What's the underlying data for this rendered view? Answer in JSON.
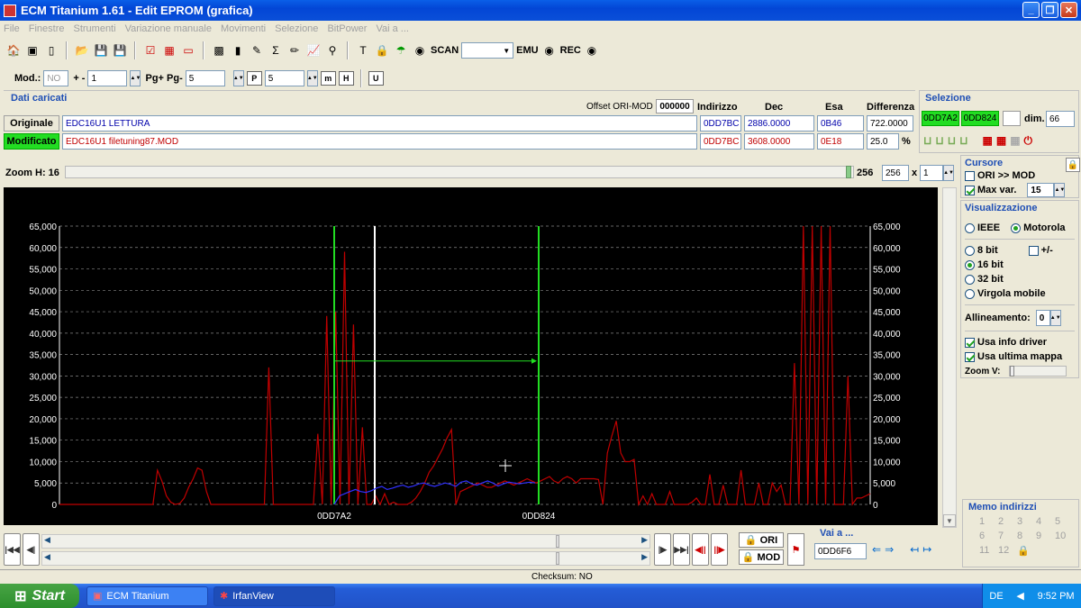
{
  "window": {
    "title": "ECM Titanium 1.61 - Edit EPROM (grafica)"
  },
  "menu": [
    "File",
    "Finestre",
    "Strumenti",
    "Variazione manuale",
    "Movimenti",
    "Selezione",
    "BitPower",
    "Vai a ..."
  ],
  "toolbar": {
    "scan_label": "SCAN",
    "emu_label": "EMU",
    "rec_label": "REC"
  },
  "toolbar2": {
    "mod_label": "Mod.:",
    "mod_value": "NO",
    "plusminus_label": "+ -",
    "plusminus_value": "1",
    "pg_label": "Pg+ Pg-",
    "pg_value": "5",
    "p_value": "5"
  },
  "dati": {
    "title": "Dati caricati",
    "offset_label": "Offset ORI-MOD",
    "offset_value": "000000",
    "col_indirizzo": "Indirizzo",
    "col_dec": "Dec",
    "col_esa": "Esa",
    "col_diff": "Differenza",
    "originale": {
      "label": "Originale",
      "file": "EDC16U1 LETTURA",
      "indirizzo": "0DD7BC",
      "dec": "2886.0000",
      "esa": "0B46",
      "diff": "722.0000"
    },
    "modificato": {
      "label": "Modificato",
      "file": "EDC16U1 filetuning87.MOD",
      "indirizzo": "0DD7BC",
      "dec": "3608.0000",
      "esa": "0E18",
      "diff": "25.0",
      "pct": "%"
    }
  },
  "selezione": {
    "title": "Selezione",
    "start": "0DD7A2",
    "end": "0DD824",
    "dim_label": "dim.",
    "dim_value": "66"
  },
  "zoom": {
    "label": "Zoom H: 16",
    "value_text": "256",
    "field": "256",
    "x_label": "x",
    "mult": "1"
  },
  "cursore": {
    "title": "Cursore",
    "ori_mod": "ORI >> MOD",
    "max_var_label": "Max var.",
    "max_var_value": "15"
  },
  "visualizzazione": {
    "title": "Visualizzazione",
    "ieee": "IEEE",
    "motorola": "Motorola",
    "bit8": "8 bit",
    "plusminus": "+/-",
    "bit16": "16 bit",
    "bit32": "32 bit",
    "virgola": "Virgola mobile",
    "allineamento_label": "Allineamento:",
    "allineamento_value": "0",
    "usa_info": "Usa info driver",
    "usa_ultima": "Usa ultima mappa",
    "zoomv_label": "Zoom V:"
  },
  "memo": {
    "title": "Memo indirizzi",
    "items": [
      "1",
      "2",
      "3",
      "4",
      "5",
      "6",
      "7",
      "8",
      "9",
      "10",
      "11",
      "12"
    ]
  },
  "bottom": {
    "ori_label": "ORI",
    "mod_label": "MOD",
    "vai_title": "Vai a ...",
    "vai_value": "0DD6F6",
    "checksum": "Checksum: NO"
  },
  "taskbar": {
    "start": "Start",
    "task1": "ECM Titanium",
    "task2": "IrfanView",
    "lang": "DE",
    "time": "9:52 PM"
  },
  "chart_data": {
    "type": "line",
    "ylim": [
      0,
      65000
    ],
    "y_ticks": [
      "0",
      "5,000",
      "10,000",
      "15,000",
      "20,000",
      "25,000",
      "30,000",
      "35,000",
      "40,000",
      "45,000",
      "50,000",
      "55,000",
      "60,000",
      "65,000"
    ],
    "x_tick_labels": [
      "0DD7A2",
      "0DD824"
    ],
    "series": [
      {
        "color": "#c00000",
        "values": [
          0,
          0,
          0,
          0,
          0,
          0,
          0,
          0,
          0,
          0,
          0,
          0,
          0,
          0,
          0,
          0,
          0,
          0,
          0,
          0,
          0,
          0,
          8000,
          5500,
          2000,
          500,
          0,
          200,
          1500,
          4000,
          6000,
          8500,
          8000,
          3000,
          0,
          0,
          0,
          0,
          0,
          0,
          0,
          0,
          0,
          0,
          0,
          0,
          0,
          32000,
          0,
          0,
          0,
          0,
          0,
          0,
          0,
          0,
          0,
          0,
          16500,
          0,
          44000,
          0,
          45000,
          0,
          59000,
          0,
          42000,
          0,
          18000,
          0,
          0,
          2000,
          0,
          2500,
          0,
          500,
          0,
          0,
          0,
          500,
          1500,
          3000,
          5000,
          7500,
          9000,
          11000,
          13000,
          15500,
          17500,
          0,
          3000,
          3500,
          4000,
          4500,
          5000,
          4500,
          4000,
          4000,
          4500,
          5000,
          5500,
          5000,
          4500,
          5000,
          5500,
          6000,
          5500,
          5000,
          5500,
          6000,
          6500,
          5500,
          5000,
          6000,
          6500,
          6000,
          5000,
          6000,
          6000,
          6000,
          6000,
          5800,
          0,
          12000,
          16000,
          19500,
          12000,
          10000,
          10000,
          10500,
          0,
          2000,
          0,
          2500,
          0,
          0,
          0,
          3000,
          0,
          0,
          0,
          0,
          500,
          1500,
          0,
          0,
          7000,
          0,
          0,
          4500,
          0,
          0,
          0,
          8000,
          0,
          0,
          0,
          5000,
          0,
          0,
          5000,
          3000,
          4500,
          0,
          0,
          33000,
          0,
          65000,
          0,
          65000,
          0,
          65000,
          0,
          65000,
          0,
          0,
          0,
          30000,
          0,
          1500,
          1500,
          2000,
          2500
        ]
      },
      {
        "color": "#3030ff",
        "values": [
          0,
          2000,
          2500,
          3000,
          3500,
          3000,
          2800,
          3200,
          3800,
          4200,
          3500,
          3800,
          4200,
          4500,
          4000,
          4300,
          4800,
          5000,
          4500,
          4200,
          4600,
          5000,
          4700,
          4200,
          5200,
          5500,
          4800,
          4500,
          5000,
          5500,
          5000,
          4300,
          4800,
          5200,
          5000,
          4800,
          5000,
          5200,
          5000
        ]
      }
    ]
  }
}
